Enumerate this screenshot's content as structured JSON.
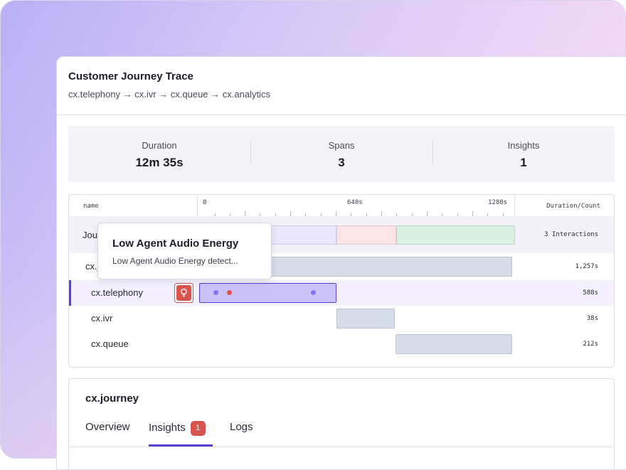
{
  "header": {
    "title": "Customer Journey Trace",
    "path": "cx.telephony → cx.ivr → cx.queue → cx.analytics"
  },
  "stats": [
    {
      "label": "Duration",
      "value": "12m 35s"
    },
    {
      "label": "Spans",
      "value": "3"
    },
    {
      "label": "Insights",
      "value": "1"
    }
  ],
  "table": {
    "col_name": "name",
    "col_duration": "Duration/Count",
    "axis_ticks": [
      "0",
      "640s",
      "1280s"
    ],
    "rows": [
      {
        "label": "Journey",
        "value": "3 Interactions"
      },
      {
        "label": "cx.journey",
        "value": "1,257s"
      },
      {
        "label": "cx.telephony",
        "value": "588s"
      },
      {
        "label": "cx.ivr",
        "value": "38s"
      },
      {
        "label": "cx.queue",
        "value": "212s"
      }
    ]
  },
  "tooltip": {
    "title": "Low Agent Audio Energy",
    "description": "Low Agent Audio Energy detect..."
  },
  "detail": {
    "title": "cx.journey",
    "tabs": [
      {
        "label": "Overview"
      },
      {
        "label": "Insights",
        "badge": "1"
      },
      {
        "label": "Logs"
      }
    ],
    "active_tab": "Insights"
  },
  "colors": {
    "accent": "#5b3fd6",
    "insight_red": "#d9534f",
    "telephony_bar": "#cbc3f8",
    "bar_gray": "#d6dce8",
    "interaction_purple": "#ebe7fc",
    "interaction_red": "#fbe5e7",
    "interaction_green": "#dcefe3"
  },
  "icons": {
    "insight_marker": "lightbulb-icon"
  }
}
